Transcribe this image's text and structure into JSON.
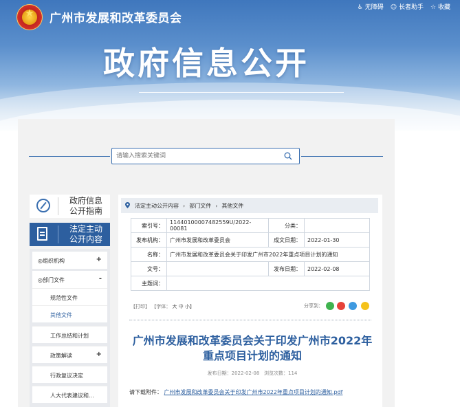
{
  "header": {
    "org_name": "广州市发展和改革委员会",
    "top_links": [
      "无障碍",
      "长者助手",
      "收藏"
    ],
    "page_title": "政府信息公开"
  },
  "search": {
    "placeholder": "请输入搜索关键词"
  },
  "sidebar": {
    "guide_line1": "政府信息",
    "guide_line2": "公开指南",
    "content_line1": "法定主动",
    "content_line2": "公开内容",
    "items": [
      {
        "label": "组织机构",
        "toggle": "+"
      },
      {
        "label": "部门文件",
        "toggle": "-"
      }
    ],
    "sub_items": [
      {
        "label": "规范性文件",
        "toggle": ""
      },
      {
        "label": "其他文件",
        "toggle": ""
      },
      {
        "label": "工作总结和计划",
        "toggle": ""
      },
      {
        "label": "政策解读",
        "toggle": "+"
      },
      {
        "label": "行政复议决定",
        "toggle": ""
      },
      {
        "label": "人大代表建议和...",
        "toggle": ""
      }
    ]
  },
  "breadcrumb": [
    "法定主动公开内容",
    "部门文件",
    "其他文件"
  ],
  "meta": {
    "index_label": "索引号：",
    "index_value": "11440100007482559U/2022-00081",
    "category_label": "分类：",
    "category_value": "",
    "publisher_label": "发布机构：",
    "publisher_value": "广州市发展和改革委员会",
    "created_label": "成文日期：",
    "created_value": "2022-01-30",
    "name_label": "名称：",
    "name_value": "广州市发展和改革委员会关于印发广州市2022年重点项目计划的通知",
    "docno_label": "文号：",
    "docno_value": "",
    "published_label": "发布日期：",
    "published_value": "2022-02-08",
    "keywords_label": "主题词：",
    "keywords_value": ""
  },
  "tools": {
    "print": "【打印】",
    "font_label": "【字体：",
    "font_large": "大",
    "font_mid": "中",
    "font_small": "小】",
    "share_label": "分享到："
  },
  "article": {
    "title_line1": "广州市发展和改革委员会关于印发广州市2022年",
    "title_line2": "重点项目计划的通知",
    "publish_label": "发布日期：",
    "publish_date": "2022-02-08",
    "views_label": "浏览次数：",
    "views": "114",
    "download_label": "请下载附件：",
    "download_link": "广州市发展和改革委员会关于印发广州市2022年重点项目计划的通知.pdf"
  },
  "colors": {
    "accent": "#2d5f9f",
    "wechat": "#3fb34f",
    "weibo": "#e6433a",
    "qq": "#3f9ae0",
    "qzone": "#f5c21b"
  }
}
